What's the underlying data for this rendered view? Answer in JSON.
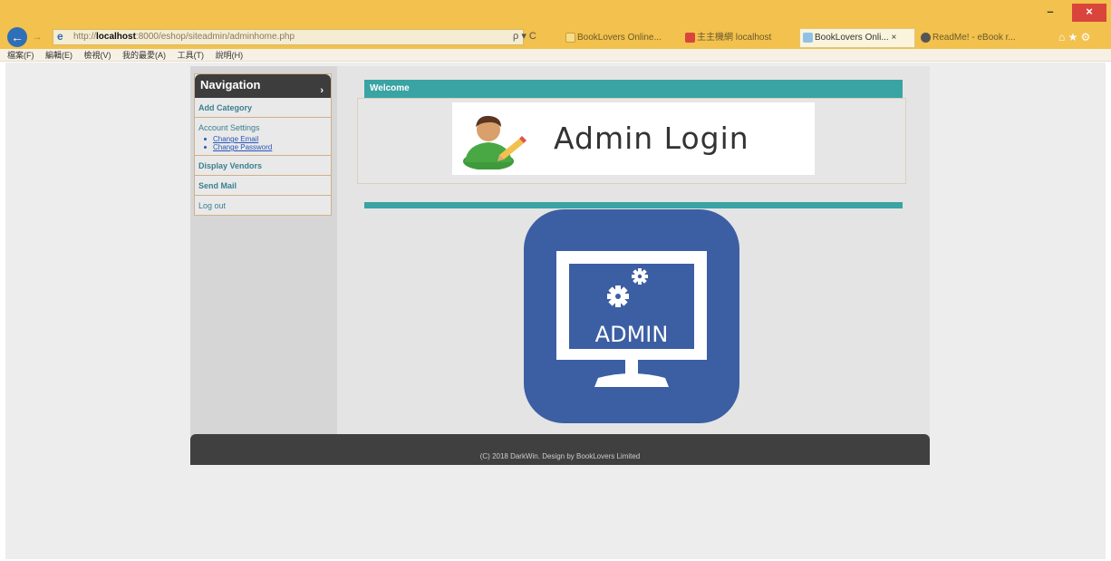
{
  "browser": {
    "url_prefix": "http://",
    "url_host": "localhost",
    "url_rest": ":8000/eshop/siteadmin/adminhome.php",
    "tabs": [
      {
        "label": "BookLovers Online...",
        "color": "#f2c14e"
      },
      {
        "label": "主主機網 localhost",
        "color": "#d9453b"
      },
      {
        "label": "BookLovers Onli... ×",
        "color": "#8fc1e8"
      },
      {
        "label": "ReadMe! - eBook r...",
        "color": "#555555"
      }
    ],
    "menu": [
      "檔案(F)",
      "編輯(E)",
      "檢視(V)",
      "我的最愛(A)",
      "工具(T)",
      "說明(H)"
    ],
    "search_refresh": "ρ ▾ C",
    "min_glyph": "–",
    "max_glyph": "❐",
    "close_glyph": "×",
    "back_glyph": "←",
    "fwd_glyph": "→",
    "home_icons": "⌂ ★ ⚙"
  },
  "nav": {
    "title": "Navigation",
    "arrow": "›",
    "items": {
      "add_category": "Add Category",
      "account_settings": "Account Settings",
      "change_email": "Change Email",
      "change_password": "Change Password",
      "display_vendors": "Display Vendors",
      "send_mail": "Send Mail",
      "log_out": "Log out"
    }
  },
  "main": {
    "welcome": "Welcome",
    "banner_text": "Admin Login",
    "admin_label": "ADMIN"
  },
  "footer": {
    "text": "(C) 2018 DarkWin. Design by BookLovers Limited"
  },
  "colors": {
    "teal": "#3aa3a3",
    "admin_blue": "#3c5fa3",
    "titlebar": "#f2c14e"
  }
}
